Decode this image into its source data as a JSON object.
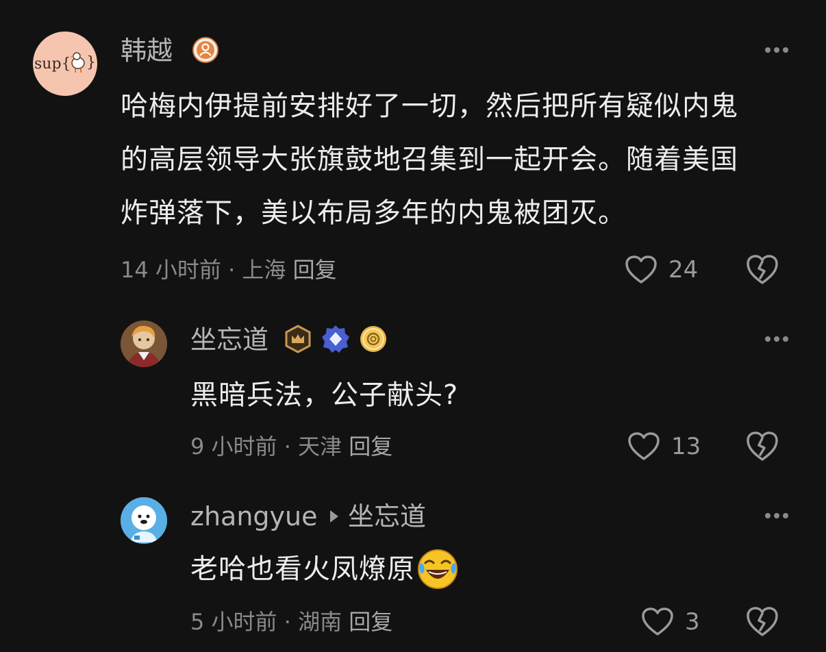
{
  "comments": [
    {
      "author": "韩越",
      "avatar_text": "sup{",
      "avatar_text2": "}",
      "badges": [
        "verified-user-icon"
      ],
      "text_lines": [
        "哈梅内伊提前安排好了一切，然后把所有疑似内鬼",
        "的高层领导大张旗鼓地召集到一起开会。随着美国",
        "炸弹落下，美以布局多年的内鬼被团灭。"
      ],
      "time": "14 小时前",
      "location": "上海",
      "reply_label": "回复",
      "likes": "24"
    },
    {
      "author": "坐忘道",
      "badges": [
        "crown-badge-icon",
        "diamond-badge-icon",
        "gold-coin-badge-icon"
      ],
      "text": "黑暗兵法，公子献头?",
      "time": "9 小时前",
      "location": "天津",
      "reply_label": "回复",
      "likes": "13"
    },
    {
      "author": "zhangyue",
      "reply_to": "坐忘道",
      "text": "老哈也看火凤燎原",
      "emoji": "laughing-crying-icon",
      "time": "5 小时前",
      "location": "湖南",
      "reply_label": "回复",
      "likes": "3"
    }
  ],
  "separator": "·",
  "colors": {
    "background": "#121212",
    "text": "#ededed",
    "muted": "#8a8a8a"
  }
}
